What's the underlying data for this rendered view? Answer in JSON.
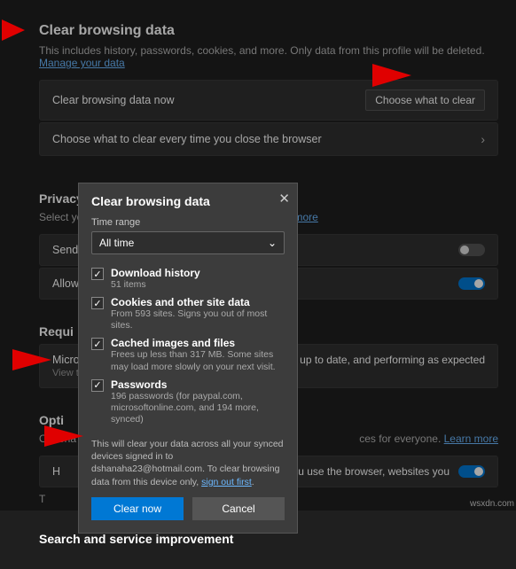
{
  "header": {
    "title": "Clear browsing data",
    "desc_prefix": "This includes history, passwords, cookies, and more. Only data from this profile will be deleted. ",
    "manage_link": "Manage your data"
  },
  "rows": {
    "now_label": "Clear browsing data now",
    "choose_btn": "Choose what to clear",
    "on_close_label": "Choose what to clear every time you close the browser"
  },
  "privacy": {
    "title": "Privacy",
    "desc_prefix": "Select your privacy settings for Microsoft Edge. ",
    "learn": "Learn more",
    "send_label": "Send",
    "allow_label": "Allow"
  },
  "required": {
    "title": "Requi",
    "micro": "Micro",
    "view": "View t",
    "tail": "ecure, up to date, and performing as expected"
  },
  "optional": {
    "title": "Opti",
    "prefix": "Optiona",
    "tail": "ces for everyone. ",
    "learn": "Learn more"
  },
  "help": {
    "h_label": "H",
    "tail": "ta about how you use the browser, websites you",
    "t_label": "T"
  },
  "bottom_title": "Search and service improvement",
  "dialog": {
    "title": "Clear browsing data",
    "time_label": "Time range",
    "time_value": "All time",
    "items": [
      {
        "checked": true,
        "title": "Download history",
        "sub": "51 items"
      },
      {
        "checked": true,
        "title": "Cookies and other site data",
        "sub": "From 593 sites. Signs you out of most sites."
      },
      {
        "checked": true,
        "title": "Cached images and files",
        "sub": "Frees up less than 317 MB. Some sites may load more slowly on your next visit."
      },
      {
        "checked": true,
        "title": "Passwords",
        "sub": "196 passwords (for paypal.com, microsoftonline.com, and 194 more, synced)"
      }
    ],
    "sync_prefix": "This will clear your data across all your synced devices signed in to dshanaha23@hotmail.com. To clear browsing data from this device only, ",
    "sync_link": "sign out first",
    "sync_suffix": ".",
    "clear_btn": "Clear now",
    "cancel_btn": "Cancel"
  },
  "corner": "wsxdn.com"
}
